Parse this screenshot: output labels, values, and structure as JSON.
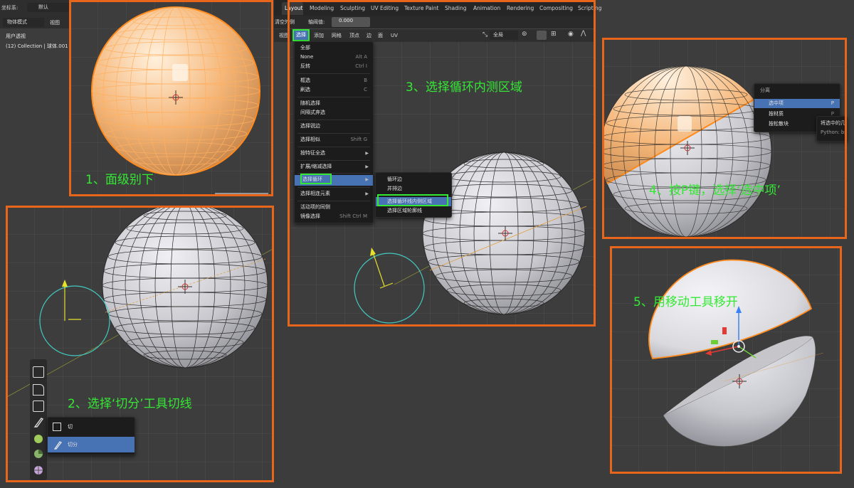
{
  "colors": {
    "frame": "#e8661c",
    "step_text": "#35e835",
    "selection": "#ffb366",
    "highlight": "#4772b3",
    "menu_bg": "#1c1c1c",
    "viewport_bg": "#3d3d3d"
  },
  "left_header": {
    "coord_label": "坐标系:",
    "coord_value": "默认",
    "mode_value": "物体模式",
    "view_label": "视图",
    "viewport_info": "用户透视",
    "collection_info": "(12) Collection | 球体.001"
  },
  "workspace_tabs": [
    "Layout",
    "Modeling",
    "Sculpting",
    "UV Editing",
    "Texture Paint",
    "Shading",
    "Animation",
    "Rendering",
    "Compositing",
    "Scripting"
  ],
  "redo_bar": {
    "left": "清空外侧",
    "label": "轴阈值:",
    "value": "0.000"
  },
  "edit_menubar": [
    "视图",
    "选择",
    "添加",
    "网格",
    "顶点",
    "边",
    "面",
    "UV"
  ],
  "header_right": {
    "orientation": "全局",
    "orientation_icon": "transform-orientation-icon"
  },
  "select_menu": {
    "items": [
      {
        "label": "全部",
        "shortcut": ""
      },
      {
        "label": "None",
        "shortcut": "Alt A"
      },
      {
        "label": "反转",
        "shortcut": "Ctrl I"
      },
      {
        "label": "框选",
        "shortcut": "B"
      },
      {
        "label": "刷选",
        "shortcut": "C"
      },
      {
        "label": "随机选择",
        "shortcut": ""
      },
      {
        "label": "间隔式弃选",
        "shortcut": ""
      },
      {
        "label": "选择锐边",
        "shortcut": ""
      },
      {
        "label": "选择相似",
        "shortcut": "Shift G"
      },
      {
        "label": "按特征全选",
        "shortcut": ""
      },
      {
        "label": "扩展/缩减选择",
        "shortcut": ""
      },
      {
        "label": "选择循环",
        "shortcut": ""
      },
      {
        "label": "选择相连元素",
        "shortcut": ""
      },
      {
        "label": "活动项的同侧",
        "shortcut": ""
      },
      {
        "label": "镜像选择",
        "shortcut": "Shift Ctrl M"
      }
    ]
  },
  "loop_submenu": [
    "循环边",
    "并排边",
    "选择循环线内侧区域",
    "选择区域轮廓线"
  ],
  "separate_menu": {
    "title": "分离",
    "items": [
      {
        "label": "选中项",
        "shortcut": "P"
      },
      {
        "label": "按材质",
        "shortcut": "P"
      },
      {
        "label": "按松散块",
        "shortcut": ""
      }
    ],
    "tooltip_line1": "将选中的几何",
    "tooltip_line2": "Python: bpy"
  },
  "knife_tools": {
    "items": [
      {
        "label": "切",
        "icon": "knife-icon"
      },
      {
        "label": "切分",
        "icon": "bisect-icon"
      }
    ]
  },
  "steps": {
    "s1": "1、面级别下",
    "s2": "2、选择‘切分’工具切线",
    "s3": "3、选择循环内测区域",
    "s4": "4、按P键，选择‘选中项’",
    "s5": "5、用移动工具移开"
  }
}
